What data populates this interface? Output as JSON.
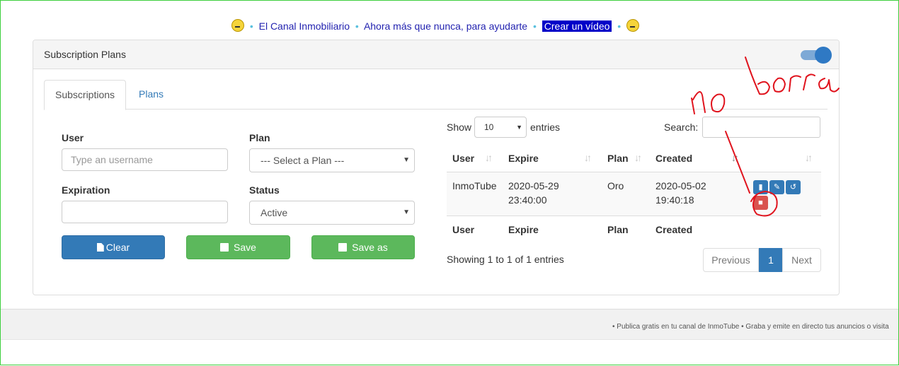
{
  "banner": {
    "left_emoji": "grimacing-face-icon",
    "link1": "El Canal Inmobiliario",
    "link2": "Ahora más que nunca, para ayudarte",
    "cta": "Crear un vídeo",
    "right_emoji": "smiley-face-icon",
    "separator": "•"
  },
  "panel": {
    "title": "Subscription Plans",
    "toggle_on": true
  },
  "tabs": [
    "Subscriptions",
    "Plans"
  ],
  "form": {
    "user_label": "User",
    "user_placeholder": "Type an username",
    "plan_label": "Plan",
    "plan_value": "--- Select a Plan ---",
    "expiration_label": "Expiration",
    "expiration_value": "",
    "status_label": "Status",
    "status_value": "Active",
    "clear_label": "Clear",
    "save_label": "Save",
    "saveas_label": "Save as"
  },
  "table": {
    "show_label": "Show",
    "entries_per_page": "10",
    "entries_label": "entries",
    "search_label": "Search:",
    "columns": [
      "User",
      "Expire",
      "Plan",
      "Created"
    ],
    "rows": [
      {
        "user": "InmoTube",
        "expire_date": "2020-05-29",
        "expire_time": "23:40:00",
        "plan": "Oro",
        "created_date": "2020-05-02",
        "created_time": "19:40:18"
      }
    ],
    "info": "Showing 1 to 1 of 1 entries",
    "pagination": {
      "previous": "Previous",
      "current": "1",
      "next": "Next"
    }
  },
  "footer": {
    "text": "• Publica gratis en tu canal de InmoTube • Graba y emite en directo tus anuncios o visita"
  },
  "annotation": {
    "text": "No borra",
    "color": "#e0141e"
  },
  "colors": {
    "primary": "#337ab7",
    "success": "#5cb85c",
    "danger": "#d9534f",
    "banner_cta": "#0000c8"
  }
}
